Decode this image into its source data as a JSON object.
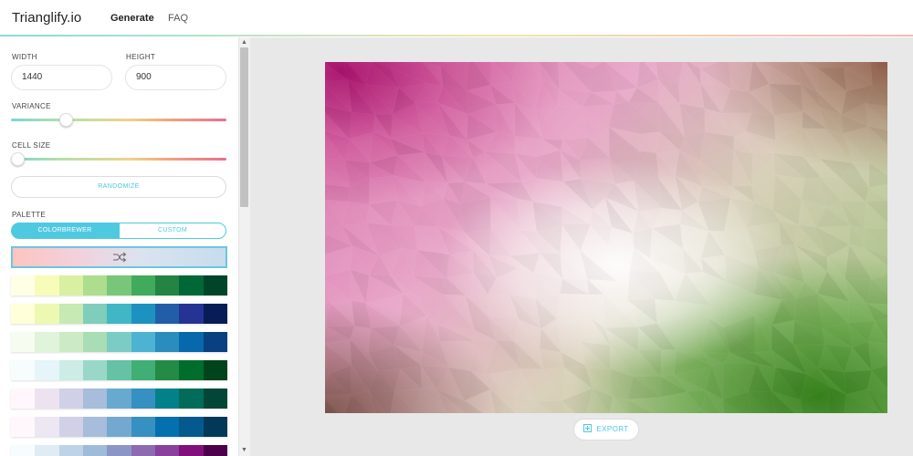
{
  "header": {
    "brand": "Trianglify.io",
    "nav": [
      {
        "label": "Generate",
        "active": true
      },
      {
        "label": "FAQ",
        "active": false
      }
    ]
  },
  "settings": {
    "width_label": "WIDTH",
    "width_value": "1440",
    "height_label": "HEIGHT",
    "height_value": "900",
    "variance_label": "VARIANCE",
    "variance_level": 0.25,
    "cell_size_label": "CELL SIZE",
    "cell_size_level": 0.0,
    "randomize_label": "RANDOMIZE",
    "palette_label": "PALETTE",
    "palette_tabs": [
      {
        "label": "COLORBREWER",
        "active": true
      },
      {
        "label": "CUSTOM",
        "active": false
      }
    ]
  },
  "palettes": [
    [
      "#ffffe5",
      "#f7fcb9",
      "#d9f0a3",
      "#addd8e",
      "#78c679",
      "#41ab5d",
      "#238443",
      "#006837",
      "#004529"
    ],
    [
      "#ffffd9",
      "#edf8b1",
      "#c7e9b4",
      "#7fcdbb",
      "#41b6c4",
      "#1d91c0",
      "#225ea8",
      "#253494",
      "#081d58"
    ],
    [
      "#f7fcf0",
      "#e0f3db",
      "#ccebc5",
      "#a8ddb5",
      "#7bccc4",
      "#4eb3d3",
      "#2b8cbe",
      "#0868ac",
      "#084081"
    ],
    [
      "#f7fcfd",
      "#e5f5f9",
      "#ccece6",
      "#99d8c9",
      "#66c2a4",
      "#41ae76",
      "#238b45",
      "#006d2c",
      "#00441b"
    ],
    [
      "#fff7fb",
      "#ece2f0",
      "#d0d1e6",
      "#a6bddb",
      "#67a9cf",
      "#3690c0",
      "#02818a",
      "#016c59",
      "#014636"
    ],
    [
      "#fff7fb",
      "#ece7f2",
      "#d0d1e6",
      "#a6bddb",
      "#74a9cf",
      "#3690c0",
      "#0570b0",
      "#045a8d",
      "#023858"
    ],
    [
      "#f7fcfd",
      "#e0ecf4",
      "#bfd3e6",
      "#9ebcda",
      "#8c96c6",
      "#8c6bb1",
      "#88419d",
      "#810f7c",
      "#4d004b"
    ]
  ],
  "export_label": "EXPORT"
}
